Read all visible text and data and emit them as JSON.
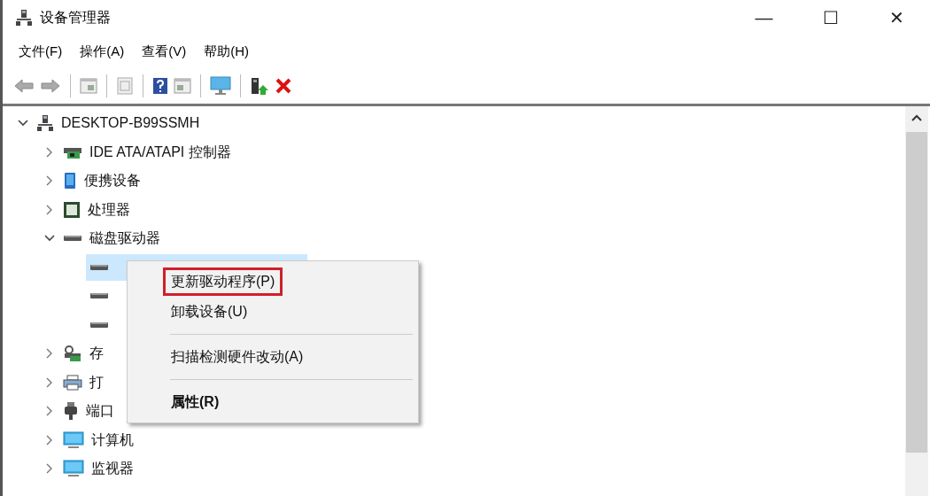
{
  "window": {
    "title": "设备管理器",
    "controls": [
      "—",
      "☐",
      "✕"
    ]
  },
  "menu_bar": [
    "文件(F)",
    "操作(A)",
    "查看(V)",
    "帮助(H)"
  ],
  "toolbar": [
    {
      "kind": "back"
    },
    {
      "kind": "forward"
    },
    {
      "kind": "separator"
    },
    {
      "kind": "tree-pane"
    },
    {
      "kind": "separator"
    },
    {
      "kind": "properties"
    },
    {
      "kind": "separator"
    },
    {
      "kind": "help"
    },
    {
      "kind": "action-pane"
    },
    {
      "kind": "separator"
    },
    {
      "kind": "monitor"
    },
    {
      "kind": "separator"
    },
    {
      "kind": "update-driver"
    },
    {
      "kind": "remove"
    }
  ],
  "tree": [
    {
      "label": "DESKTOP-B99SSMH",
      "kind": "computer",
      "expanded": true,
      "selected": false,
      "children": [
        {
          "label": "IDE ATA/ATAPI 控制器",
          "kind": "controller",
          "expanded": false,
          "selected": false
        },
        {
          "label": "便携设备",
          "kind": "portable",
          "expanded": false,
          "selected": false
        },
        {
          "label": "处理器",
          "kind": "cpu",
          "expanded": false,
          "selected": false
        },
        {
          "label": "磁盘驱动器",
          "kind": "disk",
          "expanded": true,
          "selected": false,
          "children": [
            {
              "kind": "disk",
              "selected": true
            },
            {
              "kind": "disk",
              "selected": false
            },
            {
              "kind": "disk",
              "selected": false
            }
          ]
        },
        {
          "label": "存",
          "kind": "storage",
          "expanded": false,
          "selected": false
        },
        {
          "label": "打",
          "kind": "printer",
          "expanded": false,
          "selected": false
        },
        {
          "label": "端口",
          "kind": "port",
          "expanded": false,
          "selected": false
        },
        {
          "label": "计算机",
          "kind": "screen",
          "expanded": false,
          "selected": false
        },
        {
          "label": "监视器",
          "kind": "screen",
          "expanded": false,
          "selected": false
        }
      ]
    }
  ],
  "context_menu": [
    {
      "kind": "item",
      "label": "更新驱动程序(P)",
      "outlined": true,
      "default": false
    },
    {
      "kind": "item",
      "label": "卸载设备(U)",
      "outlined": false,
      "default": false
    },
    {
      "kind": "separator"
    },
    {
      "kind": "item",
      "label": "扫描检测硬件改动(A)",
      "outlined": false,
      "default": false
    },
    {
      "kind": "separator"
    },
    {
      "kind": "item",
      "label": "属性(R)",
      "outlined": false,
      "default": true
    }
  ]
}
